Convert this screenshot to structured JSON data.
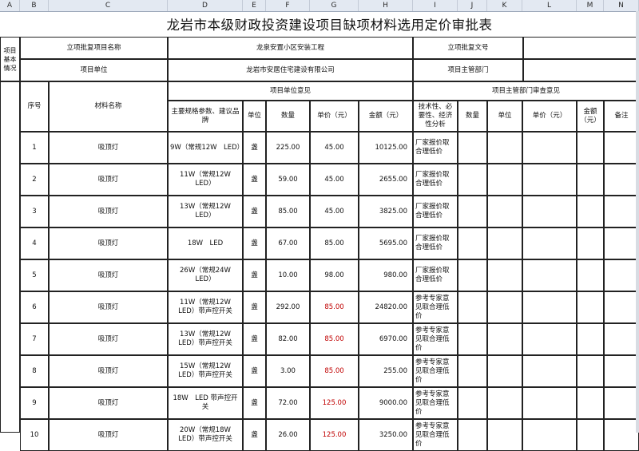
{
  "column_headers": [
    "A",
    "B",
    "C",
    "D",
    "E",
    "F",
    "G",
    "H",
    "I",
    "J",
    "K",
    "L",
    "M",
    "N"
  ],
  "title": "龙岩市本级财政投资建设项目缺项材料选用定价审批表",
  "info": {
    "section_label": "项目基本情况",
    "approval_name_label": "立项批复项目名称",
    "approval_name_value": "龙泉安置小区安装工程",
    "approval_doc_label": "立项批复文号",
    "approval_doc_value": "",
    "unit_label": "项目单位",
    "unit_value": "龙岩市安居住宅建设有限公司",
    "dept_label": "项目主管部门",
    "dept_value": ""
  },
  "groups": {
    "unit_opinion": "项目单位意见",
    "dept_opinion": "项目主管部门审查意见"
  },
  "headers": {
    "seq": "序号",
    "material": "材料名称",
    "spec": "主要规格参数、建议品牌",
    "unit": "单位",
    "qty": "数量",
    "price": "单价（元）",
    "amount": "金额（元）",
    "analysis": "技术性、必要性、经济性分析",
    "dept_qty": "数量",
    "dept_unit": "单位",
    "dept_price": "单价（元）",
    "dept_amount": "金额（元）",
    "remark": "备注"
  },
  "rows": [
    {
      "seq": "1",
      "material": "吸顶灯",
      "spec": "9W（常规12W　LED）",
      "unit": "盏",
      "qty": "225.00",
      "price": "45.00",
      "amount": "10125.00",
      "analysis": "厂家报价取合理低价",
      "price_red": false
    },
    {
      "seq": "2",
      "material": "吸顶灯",
      "spec": "11W（常规12W　LED）",
      "unit": "盏",
      "qty": "59.00",
      "price": "45.00",
      "amount": "2655.00",
      "analysis": "厂家报价取合理低价",
      "price_red": false
    },
    {
      "seq": "3",
      "material": "吸顶灯",
      "spec": "13W（常规12W　LED）",
      "unit": "盏",
      "qty": "85.00",
      "price": "45.00",
      "amount": "3825.00",
      "analysis": "厂家报价取合理低价",
      "price_red": false
    },
    {
      "seq": "4",
      "material": "吸顶灯",
      "spec": "18W　LED",
      "unit": "盏",
      "qty": "67.00",
      "price": "85.00",
      "amount": "5695.00",
      "analysis": "厂家报价取合理低价",
      "price_red": false
    },
    {
      "seq": "5",
      "material": "吸顶灯",
      "spec": "26W（常规24W　LED）",
      "unit": "盏",
      "qty": "10.00",
      "price": "98.00",
      "amount": "980.00",
      "analysis": "厂家报价取合理低价",
      "price_red": false
    },
    {
      "seq": "6",
      "material": "吸顶灯",
      "spec": "11W（常规12W　LED）带声控开关",
      "unit": "盏",
      "qty": "292.00",
      "price": "85.00",
      "amount": "24820.00",
      "analysis": "参考专家意见取合理低价",
      "price_red": true
    },
    {
      "seq": "7",
      "material": "吸顶灯",
      "spec": "13W（常规12W　LED）带声控开关",
      "unit": "盏",
      "qty": "82.00",
      "price": "85.00",
      "amount": "6970.00",
      "analysis": "参考专家意见取合理低价",
      "price_red": true
    },
    {
      "seq": "8",
      "material": "吸顶灯",
      "spec": "15W（常规12W　LED）带声控开关",
      "unit": "盏",
      "qty": "3.00",
      "price": "85.00",
      "amount": "255.00",
      "analysis": "参考专家意见取合理低价",
      "price_red": true
    },
    {
      "seq": "9",
      "material": "吸顶灯",
      "spec": "18W　LED 带声控开关",
      "unit": "盏",
      "qty": "72.00",
      "price": "125.00",
      "amount": "9000.00",
      "analysis": "参考专家意见取合理低价",
      "price_red": true
    },
    {
      "seq": "10",
      "material": "吸顶灯",
      "spec": "20W（常规18W　LED）带声控开关",
      "unit": "盏",
      "qty": "26.00",
      "price": "125.00",
      "amount": "3250.00",
      "analysis": "参考专家意见取合理低价",
      "price_red": true
    }
  ]
}
